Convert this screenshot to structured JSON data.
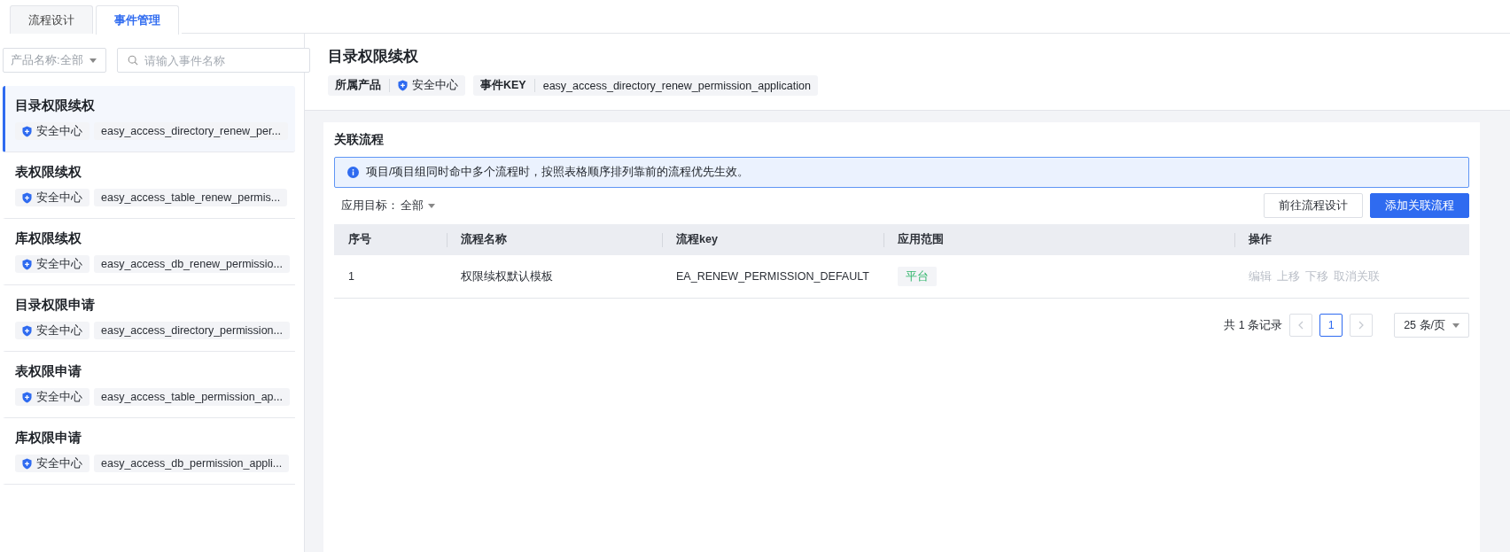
{
  "tabs": [
    {
      "label": "流程设计",
      "selected": false
    },
    {
      "label": "事件管理",
      "selected": true
    }
  ],
  "sidebar": {
    "product_filter": {
      "value": "产品名称:全部"
    },
    "search": {
      "placeholder": "请输入事件名称"
    },
    "items": [
      {
        "title": "目录权限续权",
        "product": "安全中心",
        "key": "easy_access_directory_renew_per...",
        "selected": true
      },
      {
        "title": "表权限续权",
        "product": "安全中心",
        "key": "easy_access_table_renew_permis...",
        "selected": false
      },
      {
        "title": "库权限续权",
        "product": "安全中心",
        "key": "easy_access_db_renew_permissio...",
        "selected": false
      },
      {
        "title": "目录权限申请",
        "product": "安全中心",
        "key": "easy_access_directory_permission...",
        "selected": false
      },
      {
        "title": "表权限申请",
        "product": "安全中心",
        "key": "easy_access_table_permission_ap...",
        "selected": false
      },
      {
        "title": "库权限申请",
        "product": "安全中心",
        "key": "easy_access_db_permission_appli...",
        "selected": false
      }
    ]
  },
  "detail": {
    "title": "目录权限续权",
    "product_label": "所属产品",
    "product": "安全中心",
    "key_label": "事件KEY",
    "key": "easy_access_directory_renew_permission_application"
  },
  "section": {
    "title": "关联流程",
    "alert": "项目/项目组同时命中多个流程时，按照表格顺序排列靠前的流程优先生效。",
    "target_filter": {
      "label": "应用目标：",
      "value": "全部"
    },
    "buttons": [
      {
        "label": "前往流程设计",
        "kind": "secondary"
      },
      {
        "label": "添加关联流程",
        "kind": "primary"
      }
    ],
    "table": {
      "columns": [
        "序号",
        "流程名称",
        "流程key",
        "应用范围",
        "操作"
      ],
      "rows": [
        {
          "index": "1",
          "name": "权限续权默认模板",
          "key": "EA_RENEW_PERMISSION_DEFAULT",
          "scope": "平台",
          "actions": [
            {
              "label": "编辑",
              "disabled": true
            },
            {
              "label": "上移",
              "disabled": true
            },
            {
              "label": "下移",
              "disabled": true
            },
            {
              "label": "取消关联",
              "disabled": true
            }
          ]
        }
      ]
    },
    "pagination": {
      "total": "共 1 条记录",
      "prev_disabled": true,
      "next_disabled": true,
      "pages": [
        {
          "label": "1",
          "selected": true
        }
      ],
      "page_size": "25 条/页"
    }
  }
}
